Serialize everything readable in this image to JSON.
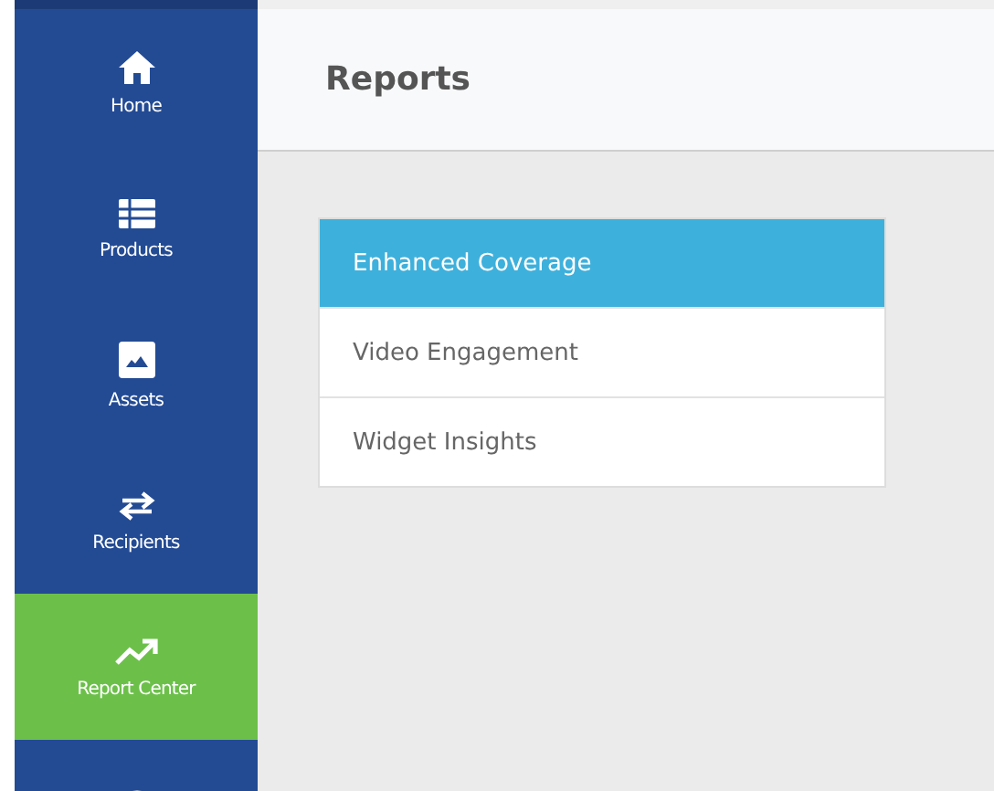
{
  "sidebar": {
    "items": [
      {
        "label": "Home",
        "selected": false
      },
      {
        "label": "Products",
        "selected": false
      },
      {
        "label": "Assets",
        "selected": false
      },
      {
        "label": "Recipients",
        "selected": false
      },
      {
        "label": "Report Center",
        "selected": true
      },
      {
        "selected": false
      }
    ]
  },
  "header": {
    "title": "Reports"
  },
  "report_list": [
    {
      "label": "Enhanced Coverage",
      "selected": true
    },
    {
      "label": "Video Engagement",
      "selected": false
    },
    {
      "label": "Widget Insights",
      "selected": false
    }
  ]
}
